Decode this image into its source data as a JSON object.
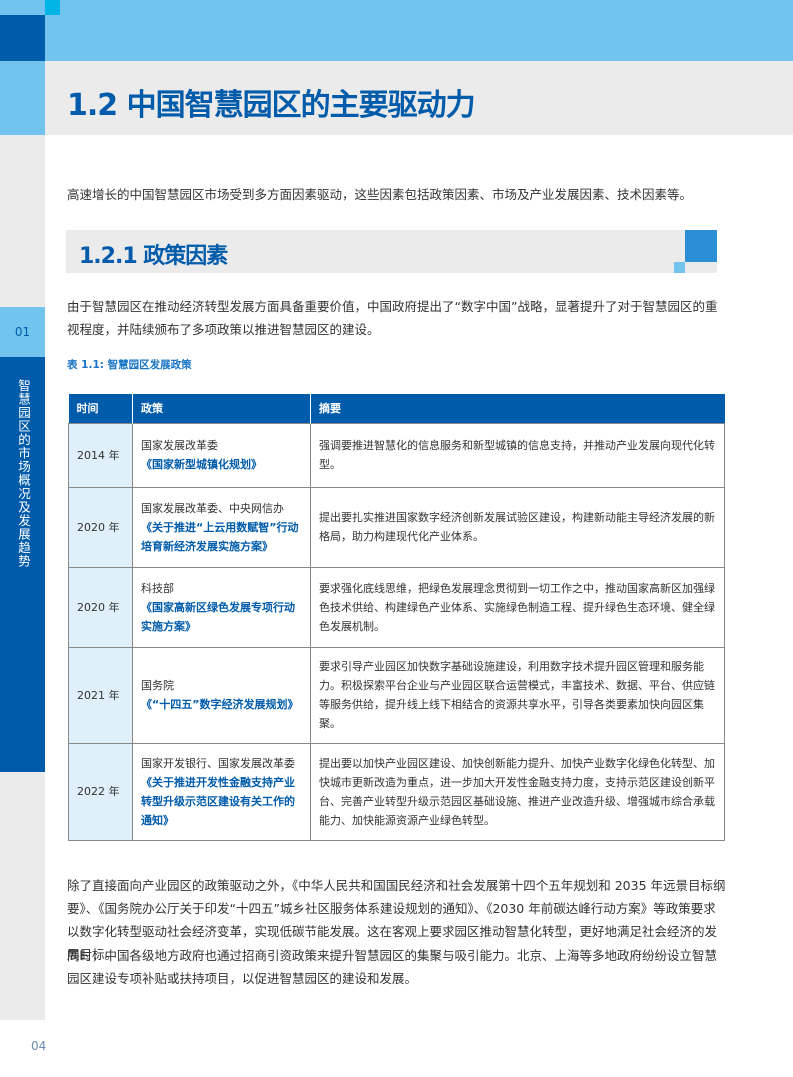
{
  "header": {
    "title": "1.2 中国智慧园区的主要驱动力"
  },
  "sidebar": {
    "chapter_number": "01",
    "chapter_title": "智慧园区的市场概况及发展趋势"
  },
  "intro": "高速增长的中国智慧园区市场受到多方面因素驱动，这些因素包括政策因素、市场及产业发展因素、技术因素等。",
  "section": {
    "title": "1.2.1 政策因素"
  },
  "paragraph1": "由于智慧园区在推动经济转型发展方面具备重要价值，中国政府提出了“数字中国”战略，显著提升了对于智慧园区的重视程度，并陆续颁布了多项政策以推进智慧园区的建设。",
  "table": {
    "caption": "表 1.1:  智慧园区发展政策",
    "headers": [
      "时间",
      "政策",
      "摘要"
    ],
    "rows": [
      {
        "year": "2014 年",
        "issuer": "国家发展改革委",
        "document": "《国家新型城镇化规划》",
        "summary": "强调要推进智慧化的信息服务和新型城镇的信息支持，并推动产业发展向现代化转型。"
      },
      {
        "year": "2020 年",
        "issuer": "国家发展改革委、中央网信办",
        "document": "《关于推进“上云用数赋智”行动培育新经济发展实施方案》",
        "summary": "提出要扎实推进国家数字经济创新发展试验区建设，构建新动能主导经济发展的新格局，助力构建现代化产业体系。"
      },
      {
        "year": "2020 年",
        "issuer": "科技部",
        "document": "《国家高新区绿色发展专项行动实施方案》",
        "summary": "要求强化底线思维，把绿色发展理念贯彻到一切工作之中，推动国家高新区加强绿色技术供给、构建绿色产业体系、实施绿色制造工程、提升绿色生态环境、健全绿色发展机制。"
      },
      {
        "year": "2021 年",
        "issuer": "国务院",
        "document": "《“十四五”数字经济发展规划》",
        "summary": "要求引导产业园区加快数字基础设施建设，利用数字技术提升园区管理和服务能力。积极探索平台企业与产业园区联合运营模式，丰富技术、数据、平台、供应链等服务供给，提升线上线下相结合的资源共享水平，引导各类要素加快向园区集聚。"
      },
      {
        "year": "2022 年",
        "issuer": "国家开发银行、国家发展改革委",
        "document": "《关于推进开发性金融支持产业转型升级示范区建设有关工作的通知》",
        "summary": "提出要以加快产业园区建设、加快创新能力提升、加快产业数字化绿色化转型、加快城市更新改造为重点，进一步加大开发性金融支持力度，支持示范区建设创新平台、完善产业转型升级示范园区基础设施、推进产业改造升级、增强城市综合承载能力、加快能源资源产业绿色转型。"
      }
    ]
  },
  "paragraph2": "除了直接面向产业园区的政策驱动之外，《中华人民共和国国民经济和社会发展第十四个五年规划和 2035 年远景目标纲要》、《国务院办公厅关于印发“十四五”城乡社区服务体系建设规划的通知》、《2030 年前碳达峰行动方案》等政策要求以数字化转型驱动社会经济变革，实现低碳节能发展。这在客观上要求园区推动智慧化转型，更好地满足社会经济的发展目标。",
  "paragraph3": "同时，中国各级地方政府也通过招商引资政策来提升智慧园区的集聚与吸引能力。北京、上海等多地政府纷纷设立智慧园区建设专项补贴或扶持项目，以促进智慧园区的建设和发展。",
  "footer": {
    "page_number": "04"
  },
  "colors": {
    "primary": "#005BAA",
    "light": "#70C4EE",
    "accent": "#00B4E6",
    "gray": "#EBEBEB"
  }
}
